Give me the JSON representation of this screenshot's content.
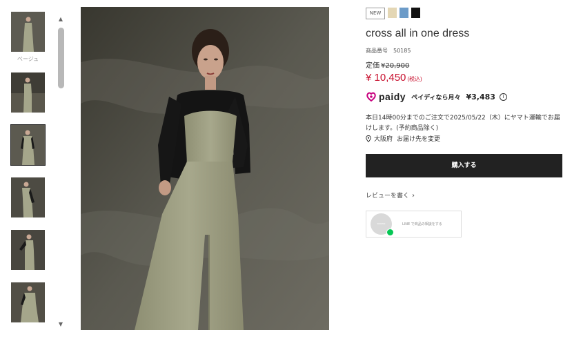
{
  "thumbnails": {
    "caption": "ベージュ",
    "scroll_up": "▲",
    "scroll_down": "▼"
  },
  "product": {
    "badge": "NEW",
    "color_swatches": [
      "#e4d7b5",
      "#6c9bc8",
      "#111111"
    ],
    "title": "cross all in one dress",
    "sku_label": "商品番号",
    "sku_value": "50185",
    "list_price_label": "定価",
    "list_price_value": "¥20,900",
    "sale_price": "¥ 10,450",
    "tax_note": "(税込)"
  },
  "paidy": {
    "logo_word": "paidy",
    "text": "ペイディなら月々",
    "amount": "¥3,483",
    "info_icon": "i"
  },
  "delivery": {
    "message": "本日14時00分までのご注文で2025/05/22（木）にヤマト運輸でお届けします。(予約商品除く)",
    "location": "大阪府",
    "change_label": "お届け先を変更"
  },
  "actions": {
    "buy_label": "購入する",
    "review_label": "レビューを書く",
    "review_chevron": "›",
    "line_avatar_text": "KNOWN",
    "line_label": "LINE で商品の相談をする"
  }
}
